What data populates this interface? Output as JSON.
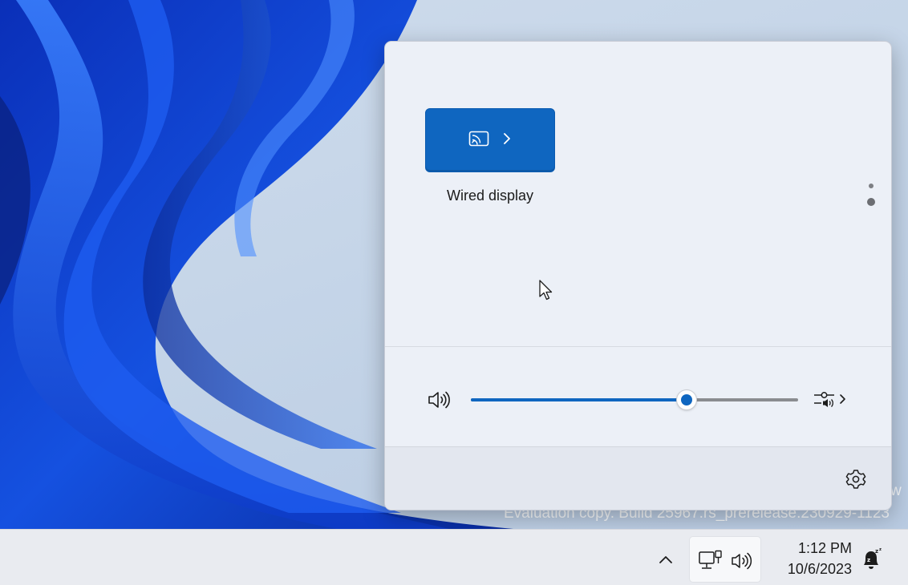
{
  "desktop": {
    "watermark_line1": "w",
    "watermark_line2": "Evaluation copy. Build 25967.rs_prerelease.230929-1123"
  },
  "quick_settings": {
    "cast_tile_label": "Wired display",
    "cast_tile_chevron": "›",
    "pages": {
      "count": 2,
      "current": 2
    },
    "volume_level": 0.66
  },
  "taskbar": {
    "time": "1:12 PM",
    "date": "10/6/2023"
  },
  "colors": {
    "accent": "#0f66c0",
    "panel_bg": "#ecf0f7",
    "taskbar_bg": "#e9ebf0"
  },
  "icons": {
    "cast": "cast-icon",
    "speaker": "speaker-icon",
    "audio_output": "audio-output-icon",
    "settings": "gear-icon",
    "overflow": "chevron-up-icon",
    "network": "network-wired-icon",
    "notifications": "notification-bell-snooze-icon",
    "cursor": "mouse-cursor-icon"
  }
}
